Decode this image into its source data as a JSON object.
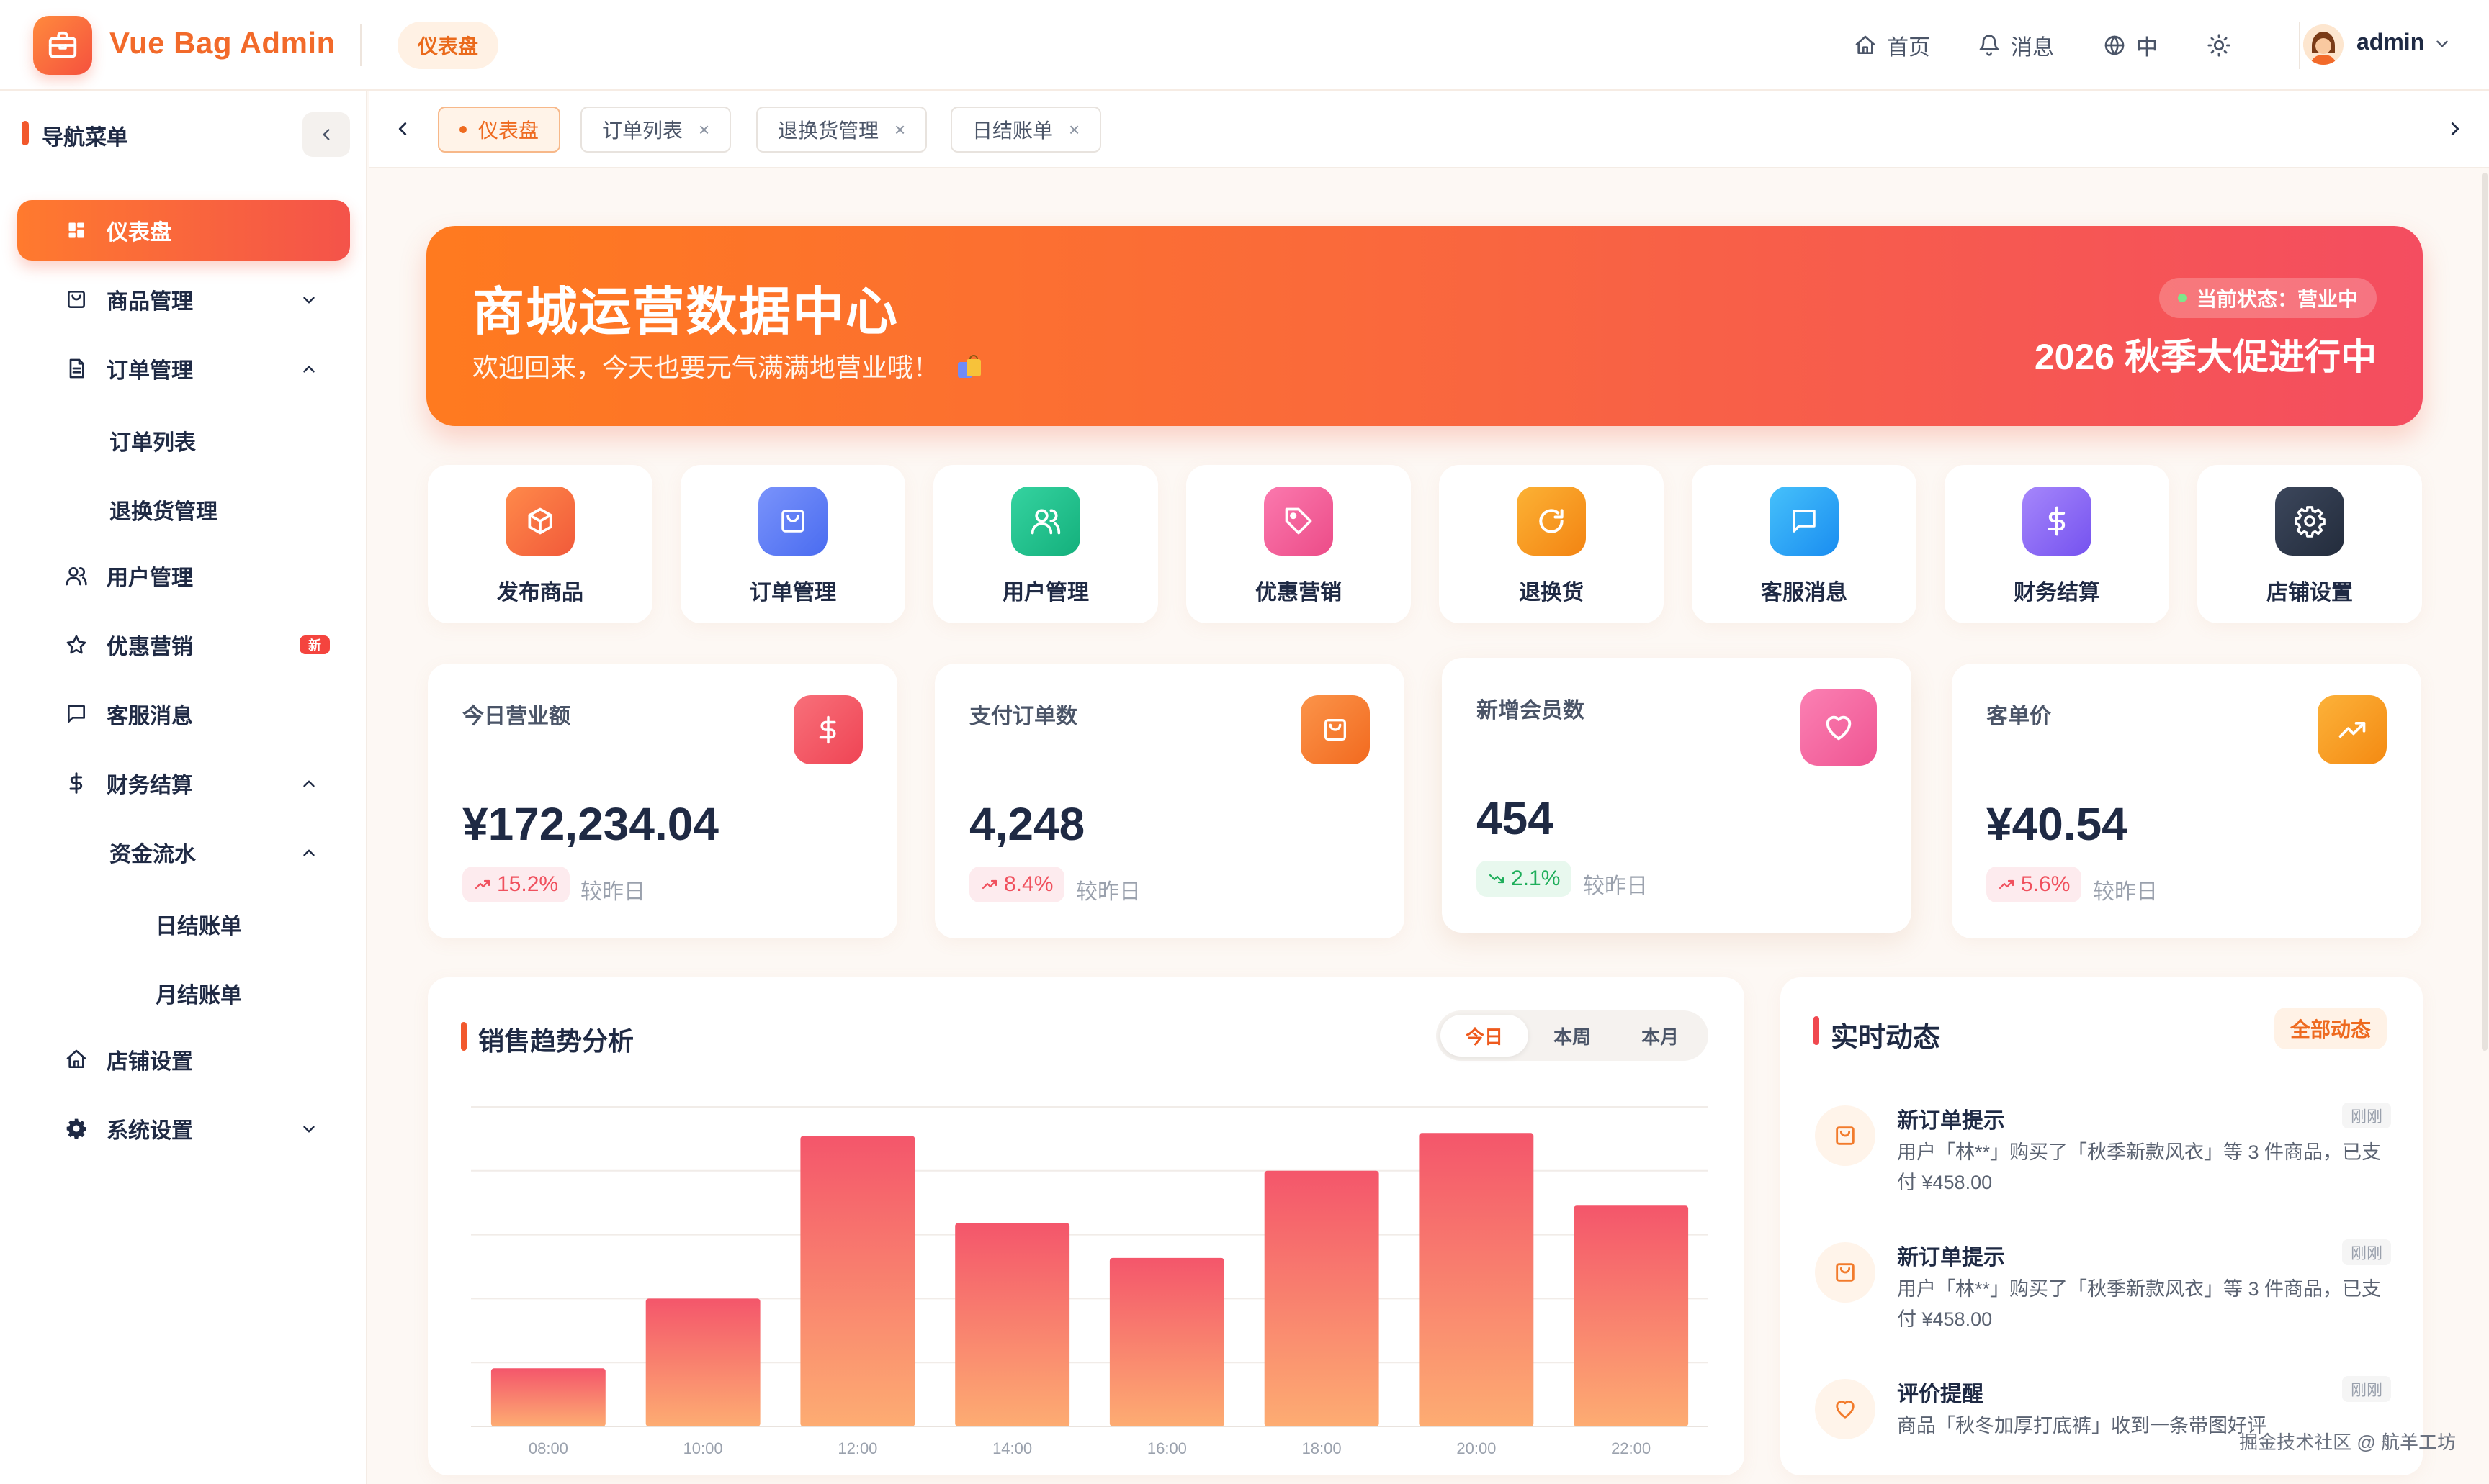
{
  "header": {
    "app_title": "Vue Bag Admin",
    "current_page": "仪表盘",
    "nav_home": "首页",
    "nav_messages": "消息",
    "nav_language": "中",
    "username": "admin"
  },
  "sidebar": {
    "title": "导航菜单",
    "items": [
      {
        "label": "仪表盘",
        "icon": "dashboard-icon"
      },
      {
        "label": "商品管理",
        "icon": "bag-icon"
      },
      {
        "label": "订单管理",
        "icon": "document-icon"
      },
      {
        "label": "订单列表"
      },
      {
        "label": "退换货管理"
      },
      {
        "label": "用户管理",
        "icon": "users-icon"
      },
      {
        "label": "优惠营销",
        "icon": "star-icon",
        "badge": "新"
      },
      {
        "label": "客服消息",
        "icon": "chat-icon"
      },
      {
        "label": "财务结算",
        "icon": "dollar-icon"
      },
      {
        "label": "资金流水"
      },
      {
        "label": "日结账单"
      },
      {
        "label": "月结账单"
      },
      {
        "label": "店铺设置",
        "icon": "home-icon"
      },
      {
        "label": "系统设置",
        "icon": "gear-icon"
      }
    ]
  },
  "tabs": [
    {
      "label": "仪表盘",
      "active": true
    },
    {
      "label": "订单列表",
      "close": "×"
    },
    {
      "label": "退换货管理",
      "close": "×"
    },
    {
      "label": "日结账单",
      "close": "×"
    }
  ],
  "banner": {
    "title": "商城运营数据中心",
    "subtitle": "欢迎回来，今天也要元气满满地营业哦！",
    "status": "当前状态：营业中",
    "promo": "2026 秋季大促进行中"
  },
  "quick_actions": [
    {
      "label": "发布商品",
      "icon": "box-icon",
      "color": "#f46a3c"
    },
    {
      "label": "订单管理",
      "icon": "bag-icon",
      "color": "#5b7cf6"
    },
    {
      "label": "用户管理",
      "icon": "users-icon",
      "color": "#1fc08f"
    },
    {
      "label": "优惠营销",
      "icon": "tag-icon",
      "color": "#f4609b"
    },
    {
      "label": "退换货",
      "icon": "refresh-icon",
      "color": "#f79a1c"
    },
    {
      "label": "客服消息",
      "icon": "chat-icon",
      "color": "#2aa6f4"
    },
    {
      "label": "财务结算",
      "icon": "dollar-icon",
      "color": "#8b68f3"
    },
    {
      "label": "店铺设置",
      "icon": "gear-icon",
      "color": "#2f3a4e"
    }
  ],
  "stats": [
    {
      "title": "今日营业额",
      "value": "¥172,234.04",
      "trend": "15.2%",
      "direction": "up",
      "compare": "较昨日",
      "icon": "dollar-icon",
      "color": "#f4515e"
    },
    {
      "title": "支付订单数",
      "value": "4,248",
      "trend": "8.4%",
      "direction": "up",
      "compare": "较昨日",
      "icon": "bag-icon",
      "color": "#f7762a"
    },
    {
      "title": "新增会员数",
      "value": "454",
      "trend": "2.1%",
      "direction": "down",
      "compare": "较昨日",
      "icon": "heart-icon",
      "color": "#f4609b"
    },
    {
      "title": "客单价",
      "value": "¥40.54",
      "trend": "5.6%",
      "direction": "up",
      "compare": "较昨日",
      "icon": "trend-up-icon",
      "color": "#f7921c"
    }
  ],
  "sales_chart": {
    "title": "销售趋势分析",
    "ranges": [
      "今日",
      "本周",
      "本月"
    ],
    "active_range": "今日"
  },
  "chart_data": {
    "type": "bar",
    "categories": [
      "08:00",
      "10:00",
      "12:00",
      "14:00",
      "16:00",
      "18:00",
      "20:00",
      "22:00"
    ],
    "values": [
      20,
      44,
      100,
      70,
      58,
      88,
      101,
      76
    ],
    "ylim": [
      0,
      110
    ],
    "grid": true,
    "legend": "none",
    "bar_gradient": [
      "#f4566b",
      "#fdac72"
    ]
  },
  "feed": {
    "title": "实时动态",
    "all_label": "全部动态",
    "items": [
      {
        "title": "新订单提示",
        "time": "刚刚",
        "desc": "用户「林**」购买了「秋季新款风衣」等 3 件商品，已支付 ¥458.00",
        "icon": "bag-icon"
      },
      {
        "title": "新订单提示",
        "time": "刚刚",
        "desc": "用户「林**」购买了「秋季新款风衣」等 3 件商品，已支付 ¥458.00",
        "icon": "bag-icon"
      },
      {
        "title": "评价提醒",
        "time": "刚刚",
        "desc": "商品「秋冬加厚打底裤」收到一条带图好评",
        "icon": "heart-icon"
      }
    ]
  },
  "watermark": "掘金技术社区 @ 航羊工坊"
}
